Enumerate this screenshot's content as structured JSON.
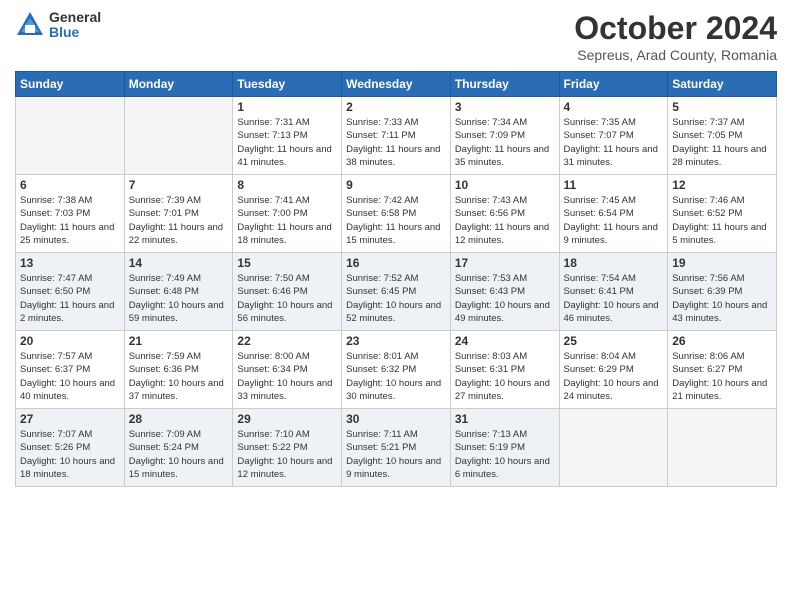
{
  "header": {
    "logo_general": "General",
    "logo_blue": "Blue",
    "title": "October 2024",
    "location": "Sepreus, Arad County, Romania"
  },
  "days_of_week": [
    "Sunday",
    "Monday",
    "Tuesday",
    "Wednesday",
    "Thursday",
    "Friday",
    "Saturday"
  ],
  "weeks": [
    [
      {
        "day": "",
        "info": ""
      },
      {
        "day": "",
        "info": ""
      },
      {
        "day": "1",
        "info": "Sunrise: 7:31 AM\nSunset: 7:13 PM\nDaylight: 11 hours and 41 minutes."
      },
      {
        "day": "2",
        "info": "Sunrise: 7:33 AM\nSunset: 7:11 PM\nDaylight: 11 hours and 38 minutes."
      },
      {
        "day": "3",
        "info": "Sunrise: 7:34 AM\nSunset: 7:09 PM\nDaylight: 11 hours and 35 minutes."
      },
      {
        "day": "4",
        "info": "Sunrise: 7:35 AM\nSunset: 7:07 PM\nDaylight: 11 hours and 31 minutes."
      },
      {
        "day": "5",
        "info": "Sunrise: 7:37 AM\nSunset: 7:05 PM\nDaylight: 11 hours and 28 minutes."
      }
    ],
    [
      {
        "day": "6",
        "info": "Sunrise: 7:38 AM\nSunset: 7:03 PM\nDaylight: 11 hours and 25 minutes."
      },
      {
        "day": "7",
        "info": "Sunrise: 7:39 AM\nSunset: 7:01 PM\nDaylight: 11 hours and 22 minutes."
      },
      {
        "day": "8",
        "info": "Sunrise: 7:41 AM\nSunset: 7:00 PM\nDaylight: 11 hours and 18 minutes."
      },
      {
        "day": "9",
        "info": "Sunrise: 7:42 AM\nSunset: 6:58 PM\nDaylight: 11 hours and 15 minutes."
      },
      {
        "day": "10",
        "info": "Sunrise: 7:43 AM\nSunset: 6:56 PM\nDaylight: 11 hours and 12 minutes."
      },
      {
        "day": "11",
        "info": "Sunrise: 7:45 AM\nSunset: 6:54 PM\nDaylight: 11 hours and 9 minutes."
      },
      {
        "day": "12",
        "info": "Sunrise: 7:46 AM\nSunset: 6:52 PM\nDaylight: 11 hours and 5 minutes."
      }
    ],
    [
      {
        "day": "13",
        "info": "Sunrise: 7:47 AM\nSunset: 6:50 PM\nDaylight: 11 hours and 2 minutes."
      },
      {
        "day": "14",
        "info": "Sunrise: 7:49 AM\nSunset: 6:48 PM\nDaylight: 10 hours and 59 minutes."
      },
      {
        "day": "15",
        "info": "Sunrise: 7:50 AM\nSunset: 6:46 PM\nDaylight: 10 hours and 56 minutes."
      },
      {
        "day": "16",
        "info": "Sunrise: 7:52 AM\nSunset: 6:45 PM\nDaylight: 10 hours and 52 minutes."
      },
      {
        "day": "17",
        "info": "Sunrise: 7:53 AM\nSunset: 6:43 PM\nDaylight: 10 hours and 49 minutes."
      },
      {
        "day": "18",
        "info": "Sunrise: 7:54 AM\nSunset: 6:41 PM\nDaylight: 10 hours and 46 minutes."
      },
      {
        "day": "19",
        "info": "Sunrise: 7:56 AM\nSunset: 6:39 PM\nDaylight: 10 hours and 43 minutes."
      }
    ],
    [
      {
        "day": "20",
        "info": "Sunrise: 7:57 AM\nSunset: 6:37 PM\nDaylight: 10 hours and 40 minutes."
      },
      {
        "day": "21",
        "info": "Sunrise: 7:59 AM\nSunset: 6:36 PM\nDaylight: 10 hours and 37 minutes."
      },
      {
        "day": "22",
        "info": "Sunrise: 8:00 AM\nSunset: 6:34 PM\nDaylight: 10 hours and 33 minutes."
      },
      {
        "day": "23",
        "info": "Sunrise: 8:01 AM\nSunset: 6:32 PM\nDaylight: 10 hours and 30 minutes."
      },
      {
        "day": "24",
        "info": "Sunrise: 8:03 AM\nSunset: 6:31 PM\nDaylight: 10 hours and 27 minutes."
      },
      {
        "day": "25",
        "info": "Sunrise: 8:04 AM\nSunset: 6:29 PM\nDaylight: 10 hours and 24 minutes."
      },
      {
        "day": "26",
        "info": "Sunrise: 8:06 AM\nSunset: 6:27 PM\nDaylight: 10 hours and 21 minutes."
      }
    ],
    [
      {
        "day": "27",
        "info": "Sunrise: 7:07 AM\nSunset: 5:26 PM\nDaylight: 10 hours and 18 minutes."
      },
      {
        "day": "28",
        "info": "Sunrise: 7:09 AM\nSunset: 5:24 PM\nDaylight: 10 hours and 15 minutes."
      },
      {
        "day": "29",
        "info": "Sunrise: 7:10 AM\nSunset: 5:22 PM\nDaylight: 10 hours and 12 minutes."
      },
      {
        "day": "30",
        "info": "Sunrise: 7:11 AM\nSunset: 5:21 PM\nDaylight: 10 hours and 9 minutes."
      },
      {
        "day": "31",
        "info": "Sunrise: 7:13 AM\nSunset: 5:19 PM\nDaylight: 10 hours and 6 minutes."
      },
      {
        "day": "",
        "info": ""
      },
      {
        "day": "",
        "info": ""
      }
    ]
  ]
}
